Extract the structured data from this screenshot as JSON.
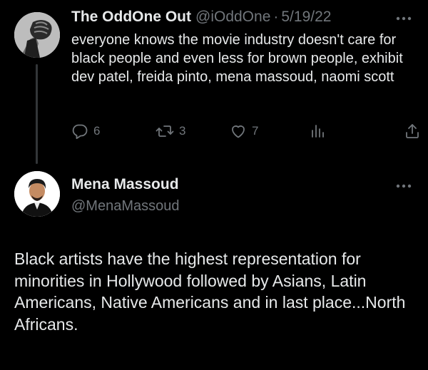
{
  "reply": {
    "display_name": "The OddOne Out",
    "handle": "@iOddOne",
    "separator": "·",
    "date": "5/19/22",
    "text": "everyone knows the movie industry doesn't care for black people and even less for brown people, exhibit dev patel, freida pinto, mena massoud, naomi scott",
    "actions": {
      "replies": "6",
      "retweets": "3",
      "likes": "7"
    },
    "avatar_icon": "raised-fist-avatar",
    "more_icon": "more-dots-icon"
  },
  "tweet": {
    "display_name": "Mena Massoud",
    "handle": "@MenaMassoud",
    "text": "Black artists have the highest representation for minorities in Hollywood followed by Asians, Latin Americans, Native Americans and in last place...North Africans.",
    "avatar_icon": "profile-photo-avatar",
    "more_icon": "more-dots-icon"
  },
  "colors": {
    "background": "#000000",
    "primary_text": "#e7e9ea",
    "secondary_text": "#71767b",
    "thread_line": "#333639"
  }
}
